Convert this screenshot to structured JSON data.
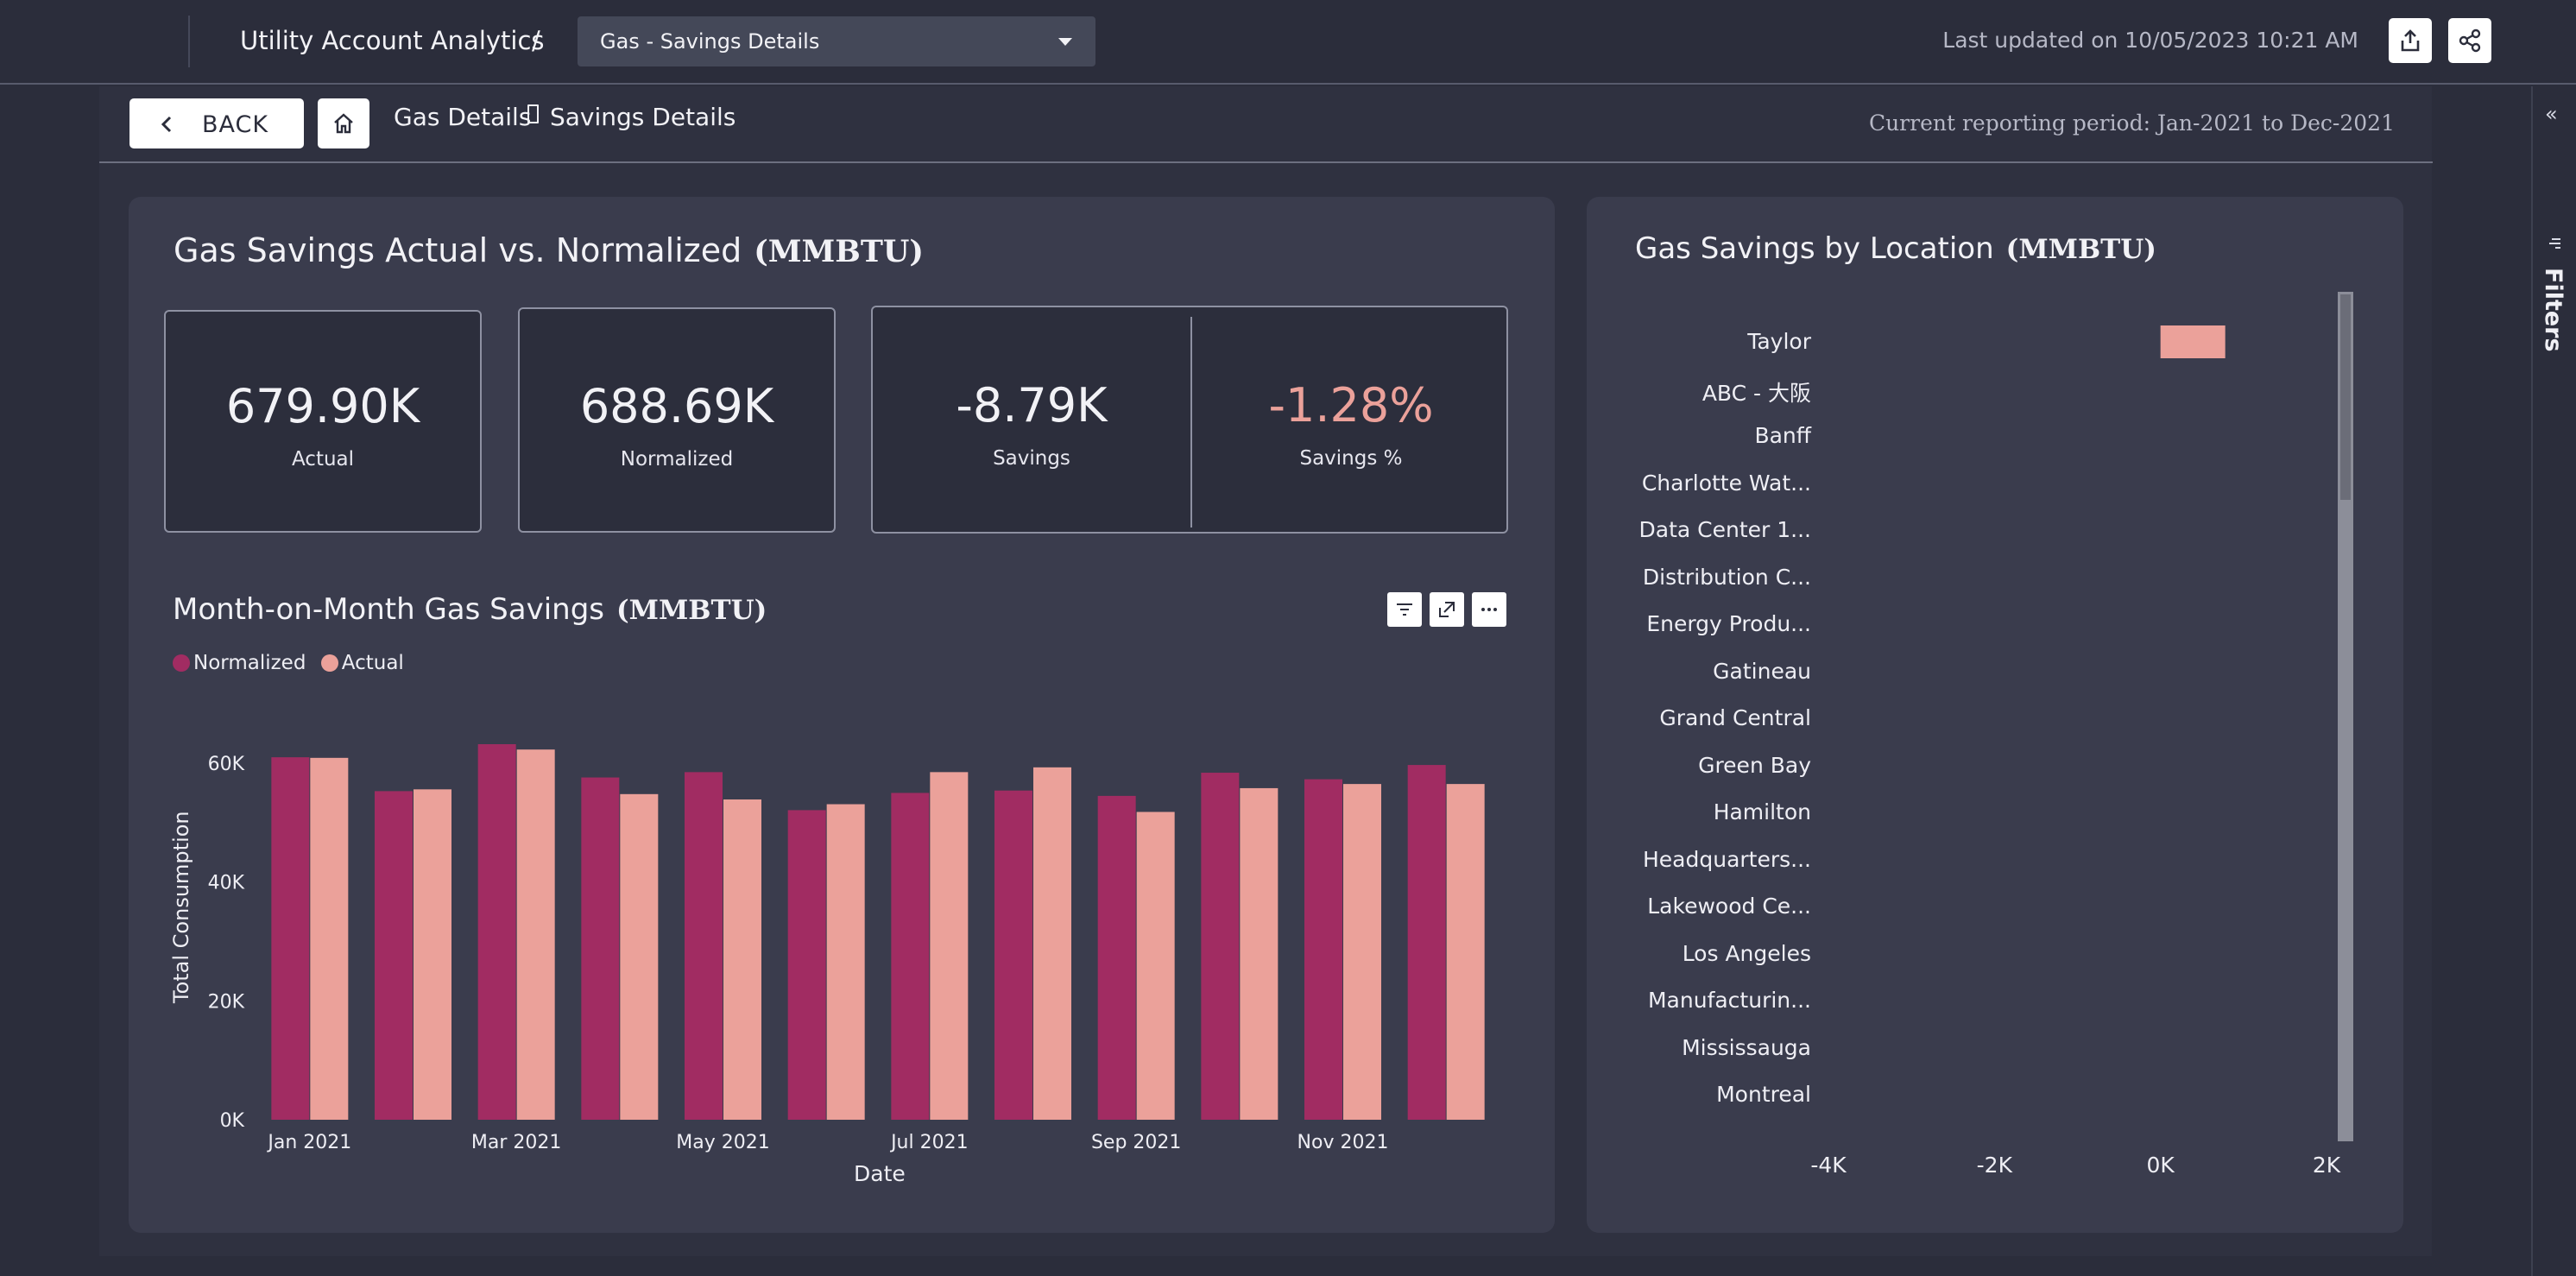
{
  "header": {
    "app_title": "Utility Account Analytics",
    "separator": "/",
    "page_select_value": "Gas - Savings Details",
    "last_updated": "Last updated on 10/05/2023 10:21 AM"
  },
  "nav": {
    "back_label": "BACK",
    "breadcrumb": [
      "Gas Details",
      "Savings Details"
    ],
    "reporting_period": "Current reporting period: Jan-2021 to Dec-2021"
  },
  "filters_pane": {
    "label": "Filters"
  },
  "actual_vs_normalized": {
    "title": "Gas Savings Actual vs. Normalized",
    "unit": "(MMBTU)",
    "kpis": {
      "actual": {
        "value": "679.90K",
        "label": "Actual"
      },
      "normalized": {
        "value": "688.69K",
        "label": "Normalized"
      },
      "savings": {
        "value": "-8.79K",
        "label": "Savings"
      },
      "savings_pct": {
        "value": "-1.28%",
        "label": "Savings %"
      }
    }
  },
  "mom_chart": {
    "title": "Month-on-Month Gas Savings",
    "unit": "(MMBTU)",
    "tools": [
      "filter-icon",
      "focus-mode-icon",
      "more-options-icon"
    ]
  },
  "location_chart": {
    "title": "Gas Savings by Location",
    "unit": "(MMBTU)"
  },
  "colors": {
    "normalized": "#a12c62",
    "actual": "#eba19a",
    "negative_kpi": "#eba19a",
    "panel": "#3a3c4d"
  },
  "chart_data": [
    {
      "type": "bar",
      "x": [
        "Jan 2021",
        "Feb 2021",
        "Mar 2021",
        "Apr 2021",
        "May 2021",
        "Jun 2021",
        "Jul 2021",
        "Aug 2021",
        "Sep 2021",
        "Oct 2021",
        "Nov 2021",
        "Dec 2021"
      ],
      "xticks": [
        "Jan 2021",
        "Mar 2021",
        "May 2021",
        "Jul 2021",
        "Sep 2021",
        "Nov 2021"
      ],
      "series": [
        {
          "name": "Normalized",
          "values": [
            61000,
            55300,
            63200,
            57600,
            58500,
            52100,
            55000,
            55400,
            54500,
            58400,
            57300,
            59700
          ]
        },
        {
          "name": "Actual",
          "values": [
            60900,
            55600,
            62300,
            54800,
            53900,
            53100,
            58500,
            59300,
            51800,
            55800,
            56500,
            56500
          ]
        }
      ],
      "xlabel": "Date",
      "ylabel": "Total Consumption",
      "ylim": [
        0,
        63200
      ],
      "yticks": [
        "0K",
        "20K",
        "40K",
        "60K"
      ],
      "legend": "top-left"
    },
    {
      "type": "bar",
      "orientation": "horizontal",
      "categories": [
        "Taylor",
        "ABC - 大阪",
        "Banff",
        "Charlotte Wat...",
        "Data Center 1...",
        "Distribution C...",
        "Energy Produ...",
        "Gatineau",
        "Grand Central",
        "Green Bay",
        "Hamilton",
        "Headquarters...",
        "Lakewood Ce...",
        "Los Angeles",
        "Manufacturin...",
        "Mississauga",
        "Montreal"
      ],
      "values": [
        780,
        0,
        0,
        0,
        0,
        0,
        0,
        0,
        0,
        0,
        0,
        0,
        0,
        0,
        0,
        0,
        0
      ],
      "xlim": [
        -4000,
        2000
      ],
      "xticks": [
        "-4K",
        "-2K",
        "0K",
        "2K"
      ]
    }
  ]
}
